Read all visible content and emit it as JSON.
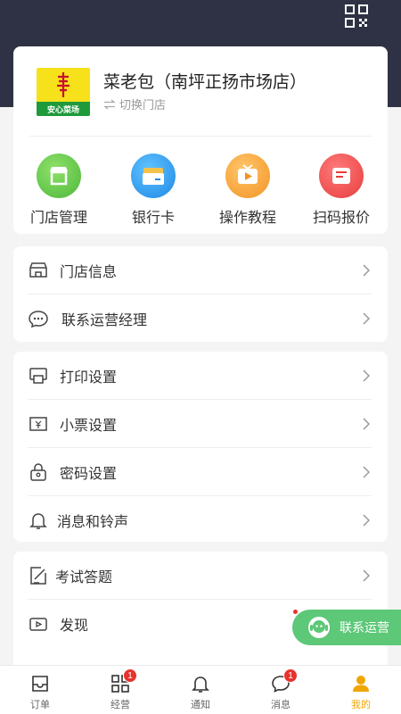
{
  "store": {
    "name": "菜老包（南坪正扬市场店）",
    "switch_label": "切换门店",
    "logo_text": "安心菜场"
  },
  "quick_actions": [
    {
      "label": "门店管理",
      "icon": "store-icon",
      "color": "#5fc24a"
    },
    {
      "label": "银行卡",
      "icon": "bank-card-icon",
      "color": "#2f9be8"
    },
    {
      "label": "操作教程",
      "icon": "video-tutorial-icon",
      "color": "#f7a13a"
    },
    {
      "label": "扫码报价",
      "icon": "scan-quote-icon",
      "color": "#ef4d4d"
    }
  ],
  "menu_group_1": [
    {
      "label": "门店信息",
      "icon": "shop-info-icon"
    },
    {
      "label": "联系运营经理",
      "icon": "chat-icon"
    }
  ],
  "menu_group_2": [
    {
      "label": "打印设置",
      "icon": "printer-icon"
    },
    {
      "label": "小票设置",
      "icon": "receipt-icon"
    },
    {
      "label": "密码设置",
      "icon": "lock-icon"
    },
    {
      "label": "消息和铃声",
      "icon": "bell-icon"
    }
  ],
  "menu_group_3": [
    {
      "label": "考试答题",
      "icon": "exam-icon"
    },
    {
      "label": "发现",
      "icon": "discover-icon"
    }
  ],
  "float_button": {
    "label": "联系运营"
  },
  "tabs": [
    {
      "label": "订单",
      "icon": "order-icon",
      "badge": ""
    },
    {
      "label": "经营",
      "icon": "grid-icon",
      "badge": "1"
    },
    {
      "label": "通知",
      "icon": "notification-icon",
      "badge": ""
    },
    {
      "label": "消息",
      "icon": "message-icon",
      "badge": "1"
    },
    {
      "label": "我的",
      "icon": "profile-icon",
      "badge": "",
      "active": true
    }
  ],
  "colors": {
    "header": "#2e3244",
    "accent": "#f0a500",
    "float": "#5cc878",
    "badge": "#e8322c"
  }
}
